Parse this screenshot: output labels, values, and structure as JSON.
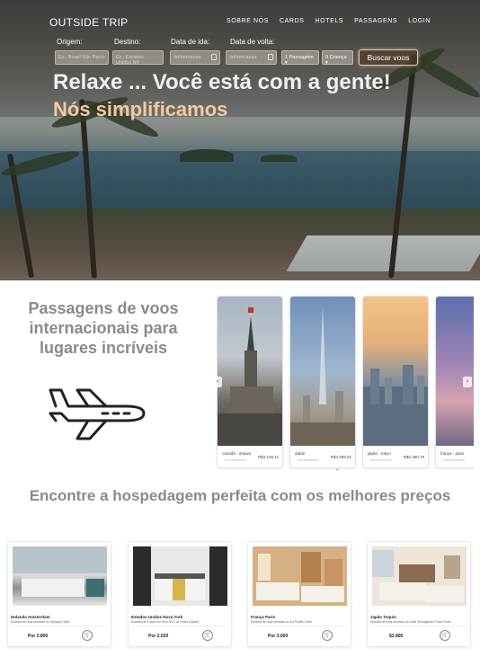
{
  "header": {
    "brand": "OUTSIDE TRIP",
    "nav": [
      "SOBRE NÓS",
      "CARDS",
      "HOTELS",
      "PASSAGENS",
      "LOGIN"
    ]
  },
  "search": {
    "labels": {
      "origin": "Origem:",
      "destination": "Destino:",
      "depart": "Data de ida:",
      "return": "Data de volta:"
    },
    "origin_placeholder": "Ex.: Brasil São Paulo",
    "destination_placeholder": "Ex.: Estados Unidos NY",
    "depart_placeholder": "dd/mm/aaaa",
    "return_placeholder": "dd/mm/aaaa",
    "passengers": "1 Passageiro",
    "children": "0 Criança",
    "button": "Buscar voos"
  },
  "hero": {
    "headline": "Relaxe ... Você está com a gente!",
    "subline": "Nós simplificamos"
  },
  "flights": {
    "title": "Passagens de voos internacionais para lugares incríveis",
    "cards": [
      {
        "name": "canadá - ottawa",
        "sub": "voo econômico",
        "price": "R$3.100,11"
      },
      {
        "name": "dubai",
        "sub": "voo econômico",
        "price": "R$4.305,01"
      },
      {
        "name": "japão - tokyo",
        "sub": "voo econômico",
        "price": "R$2.350,79"
      },
      {
        "name": "frança - paris",
        "sub": "voo econômico",
        "price": ""
      }
    ]
  },
  "hotels": {
    "title": "Encontre a hospedagem perfeita com os melhores preços",
    "cards": [
      {
        "name": "Holanda Amsterdam",
        "desc": "Estadia de uma semana no Olympic Hotel",
        "price": "Por 2.800"
      },
      {
        "name": "Estados Unidos Nova York",
        "desc": "Estadia de 4 dias em Row NYC at Times Square",
        "price": "Por 2.020"
      },
      {
        "name": "França Paris",
        "desc": "Estadia de uma semana no Au Pacific Hotel",
        "price": "Por 3.000"
      },
      {
        "name": "Japão Toquio",
        "desc": "Estadia de uma semana no hotel Shinagawa Prince Hotel",
        "price": "$3.800"
      }
    ]
  },
  "colors": {
    "accent": "#f5c9a0",
    "muted_title": "#8a8a8a"
  },
  "icons": [
    "airplane-icon",
    "calendar-icon",
    "shopping-cart-icon",
    "chevron-left-icon",
    "chevron-right-icon"
  ]
}
